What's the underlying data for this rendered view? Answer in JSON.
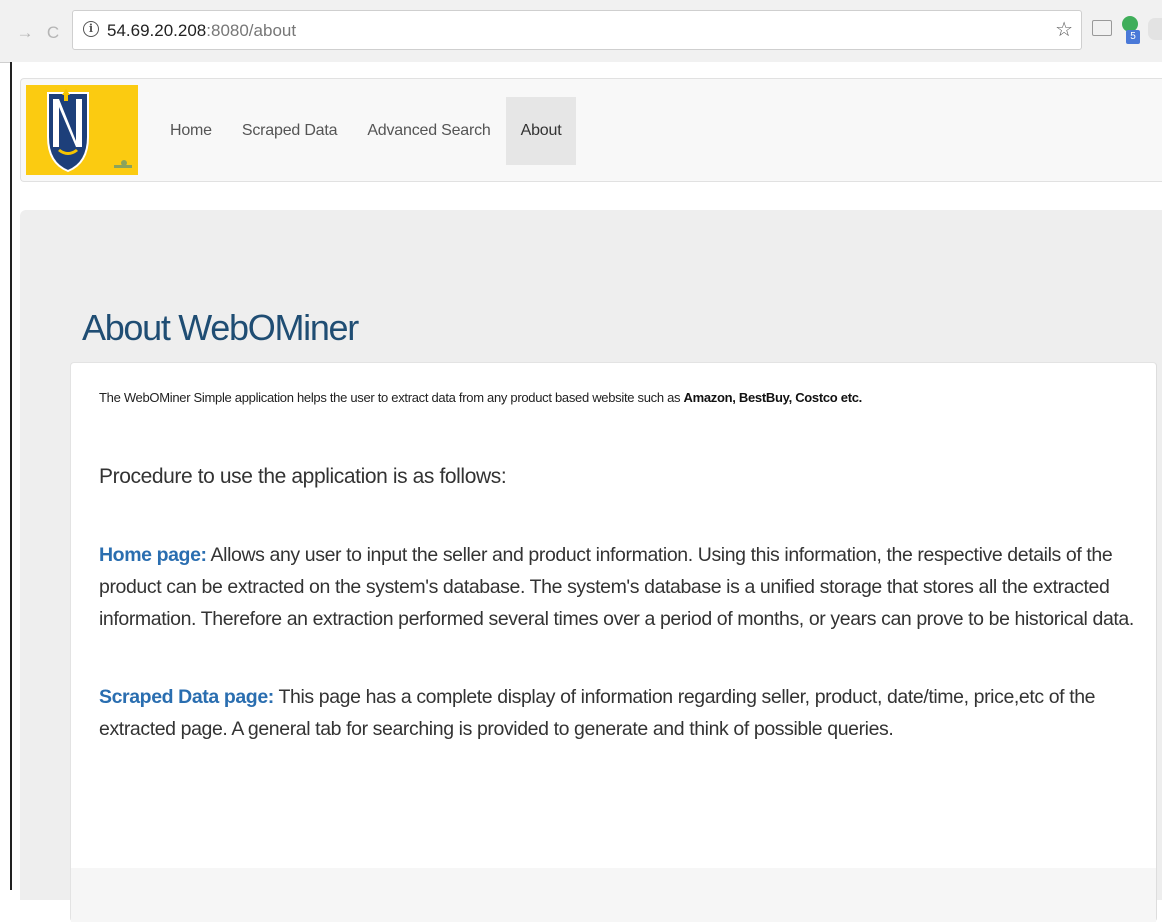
{
  "browser": {
    "url_host": "54.69.20.208",
    "url_rest": ":8080/about",
    "reload_glyph": "C",
    "back_glyph": "→",
    "info_glyph": "i",
    "star_glyph": "☆",
    "extension_badge": "5"
  },
  "navbar": {
    "items": [
      {
        "label": "Home"
      },
      {
        "label": "Scraped Data"
      },
      {
        "label": "Advanced Search"
      },
      {
        "label": "About"
      }
    ],
    "active_index": 3
  },
  "colors": {
    "logo_bg": "#fbcb11",
    "shield_blue": "#1d3f7a",
    "title": "#1f4d73",
    "section_label": "#2a6eb0"
  },
  "main": {
    "title": "About WebOMiner",
    "intro_prefix": "The WebOMiner Simple application helps the user to extract data from any product based website such as ",
    "intro_bold": "Amazon, BestBuy, Costco etc.",
    "procedure": "Procedure to use the application is as follows:",
    "sections": [
      {
        "label": "Home page:",
        "text": " Allows any user to input the seller and product information. Using this information, the respective details of the product can be extracted on the system's database. The system's database is a unified storage that stores all the extracted information. Therefore an extraction performed several times over a period of months, or years can prove to be historical data."
      },
      {
        "label": "Scraped Data page:",
        "text": " This page has a complete display of information regarding seller, product, date/time, price,etc of the extracted page. A general tab for searching is provided to generate and think of possible queries."
      }
    ]
  }
}
